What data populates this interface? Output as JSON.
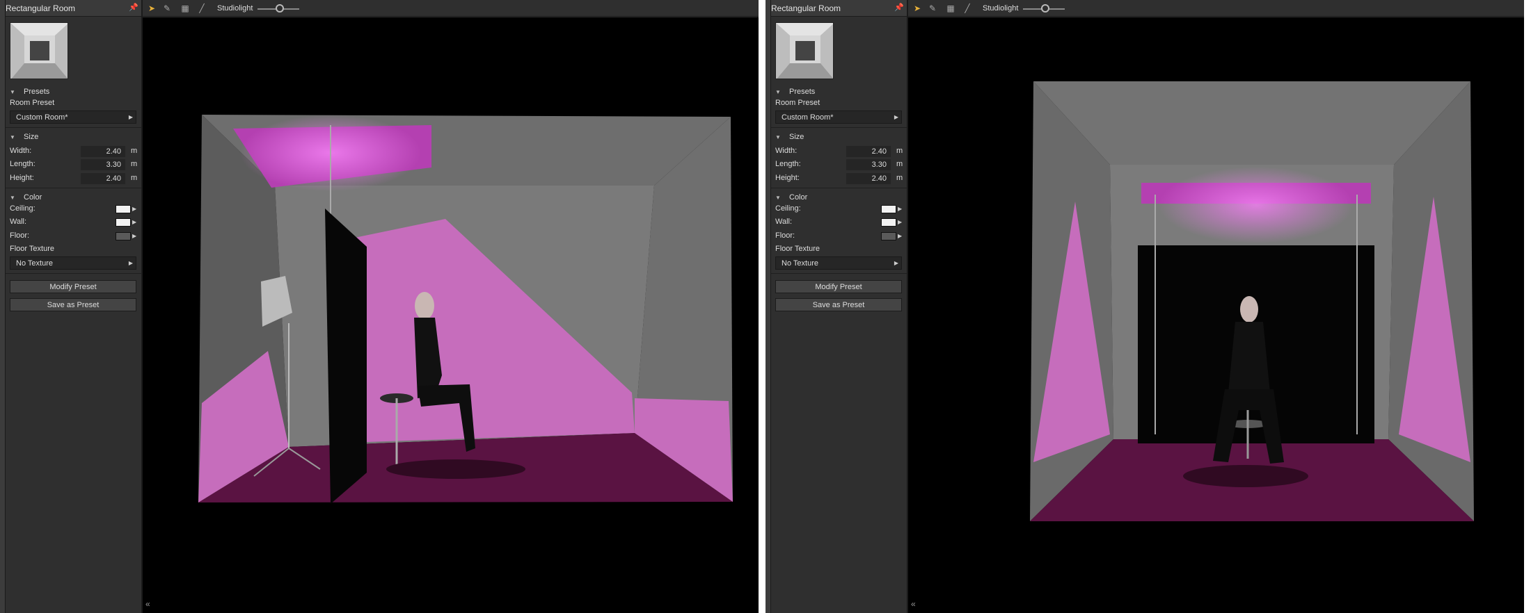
{
  "views": [
    {
      "panel": {
        "title": "Rectangular Room",
        "presets_header": "Presets",
        "room_preset_label": "Room Preset",
        "room_preset_value": "Custom Room*",
        "size_header": "Size",
        "width_label": "Width:",
        "width_value": "2.40",
        "length_label": "Length:",
        "length_value": "3.30",
        "height_label": "Height:",
        "height_value": "2.40",
        "unit": "m",
        "color_header": "Color",
        "ceiling_label": "Ceiling:",
        "wall_label": "Wall:",
        "floor_label": "Floor:",
        "floor_texture_label": "Floor Texture",
        "floor_texture_value": "No Texture",
        "modify_button": "Modify Preset",
        "save_button": "Save as Preset"
      },
      "toolbar": {
        "light_label": "Studiolight"
      }
    },
    {
      "panel": {
        "title": "Rectangular Room",
        "presets_header": "Presets",
        "room_preset_label": "Room Preset",
        "room_preset_value": "Custom Room*",
        "size_header": "Size",
        "width_label": "Width:",
        "width_value": "2.40",
        "length_label": "Length:",
        "length_value": "3.30",
        "height_label": "Height:",
        "height_value": "2.40",
        "unit": "m",
        "color_header": "Color",
        "ceiling_label": "Ceiling:",
        "wall_label": "Wall:",
        "floor_label": "Floor:",
        "floor_texture_label": "Floor Texture",
        "floor_texture_value": "No Texture",
        "modify_button": "Modify Preset",
        "save_button": "Save as Preset"
      },
      "toolbar": {
        "light_label": "Studiolight"
      }
    }
  ],
  "colors": {
    "ceiling_swatch": "#f2f2f2",
    "wall_swatch": "#f2f2f2",
    "floor_swatch": "#5a5a5a",
    "accent_pink": "#d873cf",
    "tool_select": "#e8b13a"
  },
  "icons": [
    "pin-icon",
    "chevron-down-icon",
    "arrow-right-icon",
    "select-arrow-icon",
    "pencil-icon",
    "grid-icon",
    "line-tool-icon",
    "collapse-left-icon"
  ]
}
